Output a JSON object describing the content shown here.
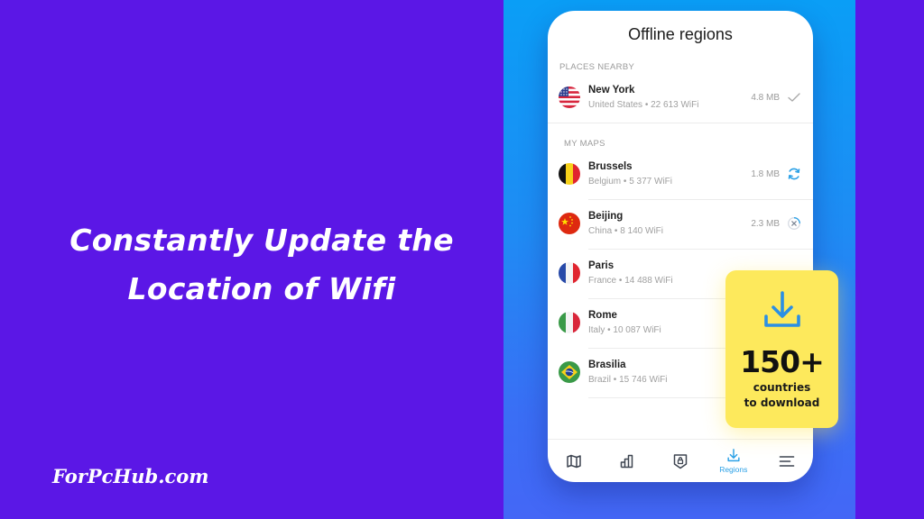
{
  "headline": {
    "line1": "Constantly Update the",
    "line2": "Location of Wifi"
  },
  "site_name": "ForPcHub.com",
  "colors": {
    "background": "#5b17e6",
    "panel_top": "#0a9ef6",
    "panel_bottom": "#4467f6",
    "accent": "#2aa0e6",
    "promo": "#fde95c"
  },
  "app": {
    "title": "Offline regions",
    "sections": [
      {
        "label": "PLACES NEARBY",
        "items": [
          {
            "city": "New York",
            "country": "United States",
            "wifi": "22 613 WiFi",
            "size": "4.8 MB",
            "flag": "us-flag",
            "status": "check-icon"
          }
        ]
      },
      {
        "label": "MY MAPS",
        "items": [
          {
            "city": "Brussels",
            "country": "Belgium",
            "wifi": "5 377 WiFi",
            "size": "1.8 MB",
            "flag": "belgium-flag",
            "status": "refresh-icon"
          },
          {
            "city": "Beijing",
            "country": "China",
            "wifi": "8 140 WiFi",
            "size": "2.3 MB",
            "flag": "china-flag",
            "status": "cancel-download-icon"
          },
          {
            "city": "Paris",
            "country": "France",
            "wifi": "14 488 WiFi",
            "size": "",
            "flag": "france-flag",
            "status": ""
          },
          {
            "city": "Rome",
            "country": "Italy",
            "wifi": "10 087 WiFi",
            "size": "",
            "flag": "italy-flag",
            "status": ""
          },
          {
            "city": "Brasilia",
            "country": "Brazil",
            "wifi": "15 746 WiFi",
            "size": "",
            "flag": "brazil-flag",
            "status": ""
          }
        ]
      }
    ],
    "separator": " • ",
    "tabs": [
      {
        "icon": "map-icon",
        "label": ""
      },
      {
        "icon": "stats-icon",
        "label": ""
      },
      {
        "icon": "vpn-shield-icon",
        "label": ""
      },
      {
        "icon": "download-icon",
        "label": "Regions",
        "active": true
      },
      {
        "icon": "menu-icon",
        "label": ""
      }
    ]
  },
  "promo": {
    "icon": "download-icon",
    "count": "150+",
    "line1": "countries",
    "line2": "to download"
  }
}
